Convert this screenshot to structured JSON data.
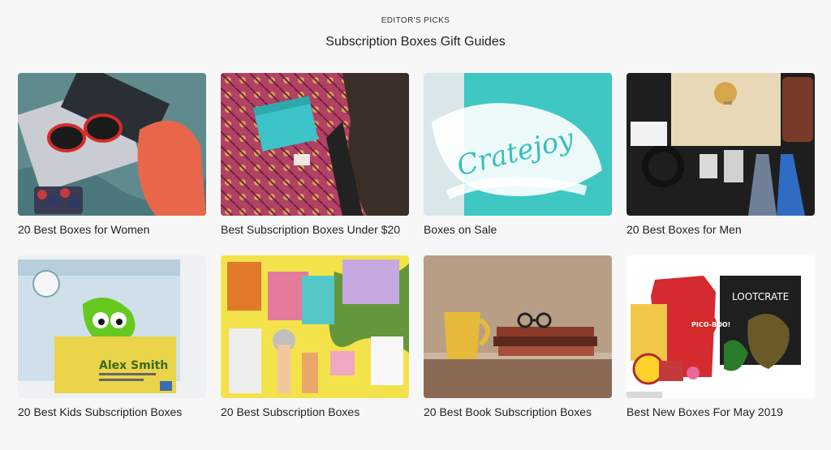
{
  "header": {
    "eyebrow": "EDITOR'S PICKS",
    "title": "Subscription Boxes Gift Guides"
  },
  "guides": [
    {
      "label": "20 Best Boxes for Women",
      "icon": "women-flatlay-image"
    },
    {
      "label": "Best Subscription Boxes Under $20",
      "icon": "rug-box-image"
    },
    {
      "label": "Boxes on Sale",
      "icon": "cratejoy-stickers-image"
    },
    {
      "label": "20 Best Boxes for Men",
      "icon": "men-box-image"
    },
    {
      "label": "20 Best Kids Subscription Boxes",
      "icon": "kids-box-image"
    },
    {
      "label": "20 Best Subscription Boxes",
      "icon": "products-flatlay-image"
    },
    {
      "label": "20 Best Book Subscription Boxes",
      "icon": "books-mug-image"
    },
    {
      "label": "Best New Boxes For May 2019",
      "icon": "lootcrate-image"
    }
  ],
  "image_text": {
    "cratejoy": "Cratejoy",
    "kids_name": "Alex Smith",
    "lootcrate": "LOOTCRATE",
    "pico": "PICO-BOO!"
  }
}
